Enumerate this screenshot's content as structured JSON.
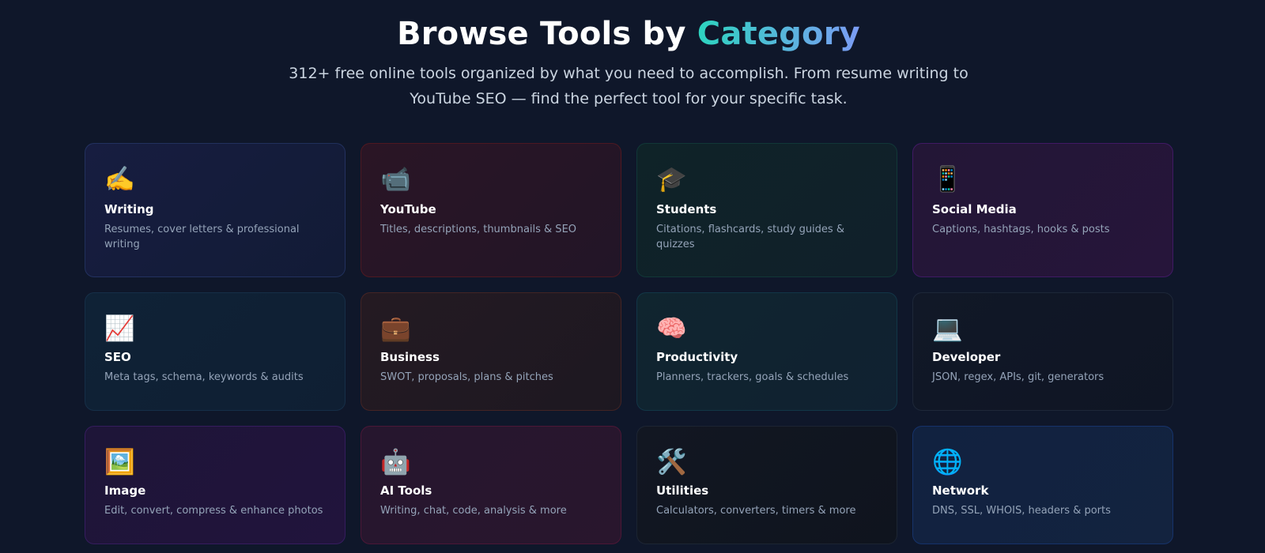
{
  "header": {
    "title_main": "Browse Tools by ",
    "title_accent": "Category",
    "subtitle": "312+ free online tools organized by what you need to accomplish. From resume writing to YouTube SEO — find the perfect tool for your specific task."
  },
  "categories": [
    {
      "icon": "✍️",
      "icon_name": "writing-hand-icon",
      "title": "Writing",
      "description": "Resumes, cover letters & professional writing"
    },
    {
      "icon": "📹",
      "icon_name": "video-camera-icon",
      "title": "YouTube",
      "description": "Titles, descriptions, thumbnails & SEO"
    },
    {
      "icon": "🎓",
      "icon_name": "graduation-cap-icon",
      "title": "Students",
      "description": "Citations, flashcards, study guides & quizzes"
    },
    {
      "icon": "📱",
      "icon_name": "mobile-phone-icon",
      "title": "Social Media",
      "description": "Captions, hashtags, hooks & posts"
    },
    {
      "icon": "📈",
      "icon_name": "chart-increasing-icon",
      "title": "SEO",
      "description": "Meta tags, schema, keywords & audits"
    },
    {
      "icon": "💼",
      "icon_name": "briefcase-icon",
      "title": "Business",
      "description": "SWOT, proposals, plans & pitches"
    },
    {
      "icon": "🧠",
      "icon_name": "brain-icon",
      "title": "Productivity",
      "description": "Planners, trackers, goals & schedules"
    },
    {
      "icon": "💻",
      "icon_name": "laptop-icon",
      "title": "Developer",
      "description": "JSON, regex, APIs, git, generators"
    },
    {
      "icon": "🖼️",
      "icon_name": "framed-picture-icon",
      "title": "Image",
      "description": "Edit, convert, compress & enhance photos"
    },
    {
      "icon": "🤖",
      "icon_name": "robot-icon",
      "title": "AI Tools",
      "description": "Writing, chat, code, analysis & more"
    },
    {
      "icon": "🛠️",
      "icon_name": "hammer-wrench-icon",
      "title": "Utilities",
      "description": "Calculators, converters, timers & more"
    },
    {
      "icon": "🌐",
      "icon_name": "globe-icon",
      "title": "Network",
      "description": "DNS, SSL, WHOIS, headers & ports"
    }
  ]
}
